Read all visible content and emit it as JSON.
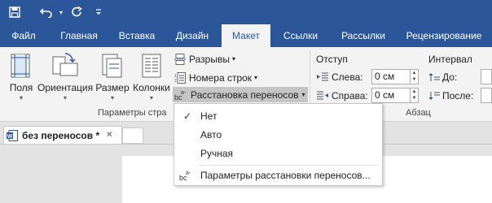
{
  "quick_access": {
    "save_icon": "save-icon",
    "undo_icon": "undo-icon",
    "redo_icon": "redo-icon",
    "customize_icon": "customize-icon"
  },
  "tabs": [
    {
      "label": "Файл"
    },
    {
      "label": "Главная"
    },
    {
      "label": "Вставка"
    },
    {
      "label": "Дизайн"
    },
    {
      "label": "Макет"
    },
    {
      "label": "Ссылки"
    },
    {
      "label": "Рассылки"
    },
    {
      "label": "Рецензирование"
    }
  ],
  "active_tab": "Макет",
  "ribbon": {
    "page_setup": {
      "buttons": [
        {
          "label": "Поля"
        },
        {
          "label": "Ориентация"
        },
        {
          "label": "Размер"
        },
        {
          "label": "Колонки"
        }
      ],
      "breaks": "Разрывы",
      "line_numbers": "Номера строк",
      "hyphenation": "Расстановка переносов",
      "group_label": "Параметры стра"
    },
    "paragraph": {
      "indent_header": "Отступ",
      "left_label": "Слева:",
      "left_value": "0 см",
      "right_label": "Справа:",
      "right_value": "0 см",
      "spacing_header": "Интервал",
      "before_label": "До:",
      "after_label": "После:",
      "group_label": "Абзац"
    }
  },
  "document": {
    "tab_title": "без переносов *",
    "close_glyph": "✕"
  },
  "hyphenation_menu": {
    "items": [
      {
        "label": "Нет",
        "checked": true
      },
      {
        "label": "Авто",
        "checked": false
      },
      {
        "label": "Ручная",
        "checked": false
      }
    ],
    "options_label": "Параметры расстановки переносов...",
    "check_glyph": "✓"
  },
  "colors": {
    "accent": "#2b579a",
    "ribbon_bg": "#f3f3f3",
    "highlight": "#c5c5c5"
  }
}
